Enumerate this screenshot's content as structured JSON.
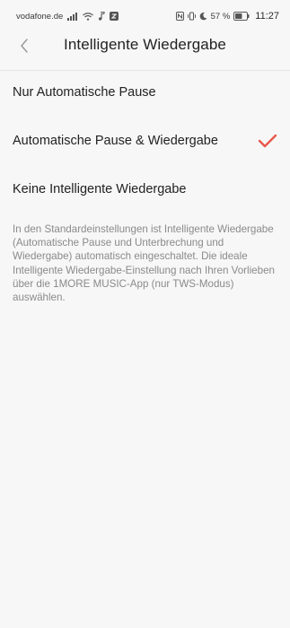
{
  "status_bar": {
    "carrier": "vodafone.de",
    "battery": "57 %",
    "time": "11:27",
    "icons": [
      "signal-icon",
      "wifi-icon",
      "music-note-icon",
      "app-notification-icon",
      "nfc-icon",
      "vibrate-icon",
      "do-not-disturb-moon-icon",
      "battery-icon"
    ]
  },
  "header": {
    "back_icon": "chevron-left-icon",
    "title": "Intelligente Wiedergabe"
  },
  "options": [
    {
      "label": "Nur Automatische Pause",
      "selected": false
    },
    {
      "label": "Automatische Pause & Wiedergabe",
      "selected": true
    },
    {
      "label": "Keine Intelligente Wiedergabe",
      "selected": false
    }
  ],
  "check_color": "#e8574b",
  "note": "In den Standardeinstellungen ist Intelligente Wiedergabe (Automatische Pause und Unterbrechung und Wiedergabe) automatisch eingeschaltet. Die ideale Intelligente Wiedergabe-Einstellung nach Ihren Vorlieben über die 1MORE MUSIC-App (nur TWS-Modus) auswählen."
}
